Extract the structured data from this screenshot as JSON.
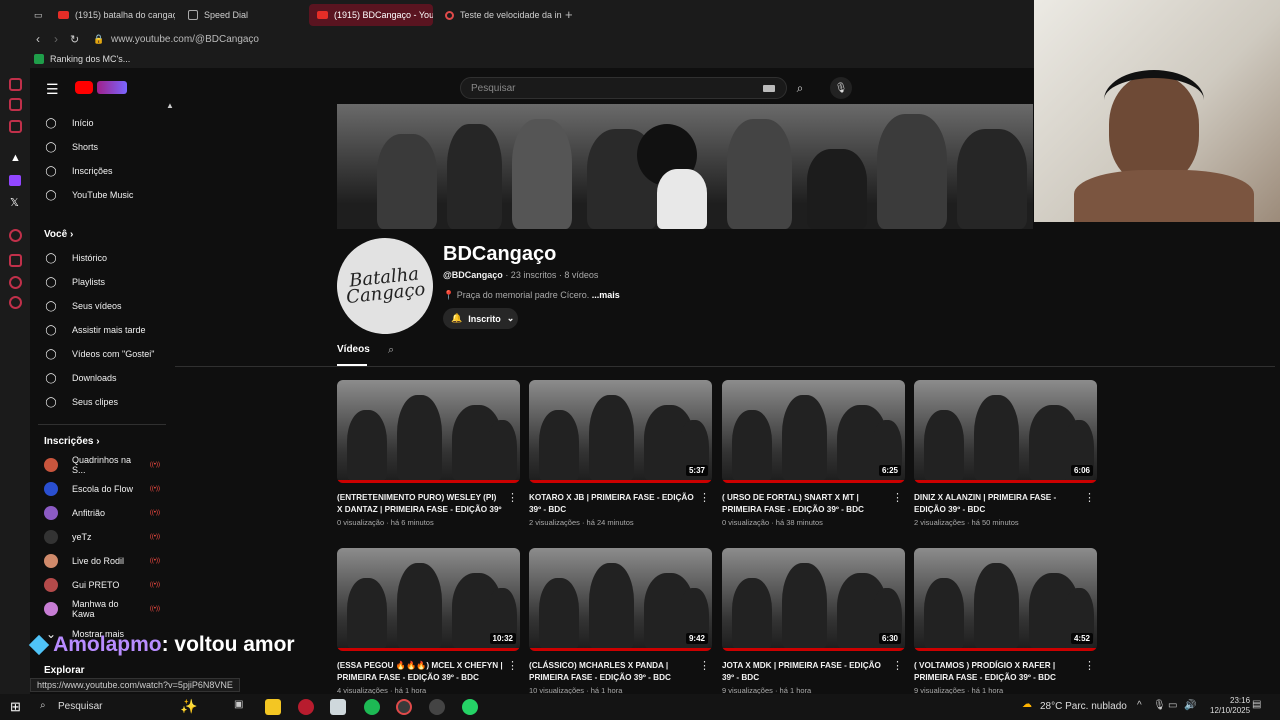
{
  "browser": {
    "tabs": [
      {
        "label": "(1915) batalha do cangaç"
      },
      {
        "label": "Speed Dial"
      },
      {
        "label": "(1915) BDCangaço - YouT"
      },
      {
        "label": "Teste de velocidade da in"
      }
    ],
    "url": "www.youtube.com/@BDCangaço",
    "bookmark": "Ranking dos MC's..."
  },
  "sidebar": {
    "main": [
      {
        "label": "Início",
        "icon": "home-icon"
      },
      {
        "label": "Shorts",
        "icon": "shorts-icon"
      },
      {
        "label": "Inscrições",
        "icon": "subscriptions-icon"
      },
      {
        "label": "YouTube Music",
        "icon": "music-icon"
      }
    ],
    "you_title": "Você",
    "you": [
      {
        "label": "Histórico",
        "icon": "history-icon"
      },
      {
        "label": "Playlists",
        "icon": "playlists-icon"
      },
      {
        "label": "Seus vídeos",
        "icon": "your-videos-icon"
      },
      {
        "label": "Assistir mais tarde",
        "icon": "watch-later-icon"
      },
      {
        "label": "Vídeos com \"Gostei\"",
        "icon": "liked-icon"
      },
      {
        "label": "Downloads",
        "icon": "downloads-icon"
      },
      {
        "label": "Seus clipes",
        "icon": "clips-icon"
      }
    ],
    "subs_title": "Inscrições",
    "subs": [
      {
        "label": "Quadrinhos na S...",
        "color": "#c8553d"
      },
      {
        "label": "Escola do Flow",
        "color": "#2a4fd0"
      },
      {
        "label": "Anfitrião",
        "color": "#8c5bc4"
      },
      {
        "label": "yeTz",
        "color": "#333333"
      },
      {
        "label": "Live do Rodil",
        "color": "#d08a6b"
      },
      {
        "label": "Gui PRETO",
        "color": "#b44a4a"
      },
      {
        "label": "Manhwa do Kawa",
        "color": "#c77dd4"
      }
    ],
    "show_more": "Mostrar mais",
    "explore": "Explorar"
  },
  "search": {
    "placeholder": "Pesquisar"
  },
  "channel": {
    "name": "BDCangaço",
    "handle": "@BDCangaço",
    "stats": "· 23 inscritos · 8 vídeos",
    "description": "📍 Praça do memorial padre Cícero.",
    "more": "...mais",
    "subscribe_label": "Inscrito",
    "avatar_text": "Batalha Cangaço"
  },
  "tabs": {
    "videos": "Vídeos"
  },
  "videos": [
    {
      "title": "(ENTRETENIMENTO PURO) WESLEY (PI) X DANTAZ | PRIMEIRA FASE - EDIÇÃO 39º -...",
      "meta": "0 visualização · há 6 minutos",
      "duration": ""
    },
    {
      "title": "KOTARO X JB | PRIMEIRA FASE - EDIÇÃO 39º - BDC",
      "meta": "2 visualizações · há 24 minutos",
      "duration": "5:37"
    },
    {
      "title": "( URSO DE FORTAL) SNART X MT | PRIMEIRA FASE - EDIÇÃO 39º - BDC",
      "meta": "0 visualização · há 38 minutos",
      "duration": "6:25"
    },
    {
      "title": "DINIZ X ALANZIN | PRIMEIRA FASE - EDIÇÃO 39º - BDC",
      "meta": "2 visualizações · há 50 minutos",
      "duration": "6:06"
    },
    {
      "title": "(ESSA PEGOU 🔥🔥🔥) MCEL X CHEFYN | PRIMEIRA FASE - EDIÇÃO 39º - BDC",
      "meta": "4 visualizações · há 1 hora",
      "duration": "10:32"
    },
    {
      "title": "(CLÁSSICO) MCHARLES X PANDA | PRIMEIRA FASE - EDIÇÃO 39º - BDC",
      "meta": "10 visualizações · há 1 hora",
      "duration": "9:42"
    },
    {
      "title": "JOTA X MDK | PRIMEIRA FASE - EDIÇÃO 39º - BDC",
      "meta": "9 visualizações · há 1 hora",
      "duration": "6:30"
    },
    {
      "title": "( VOLTAMOS ) PRODÍGIO X RAFER | PRIMEIRA FASE - EDIÇÃO 39º - BDC",
      "meta": "9 visualizações · há 1 hora",
      "duration": "4:52"
    }
  ],
  "chat": {
    "user": "Amolapmo",
    "message": ": voltou amor"
  },
  "status_url": "https://www.youtube.com/watch?v=5pjiP6N8VNE",
  "taskbar": {
    "search": "Pesquisar",
    "weather": "28°C  Parc. nublado",
    "time": "23:16",
    "date": "12/10/2025"
  }
}
